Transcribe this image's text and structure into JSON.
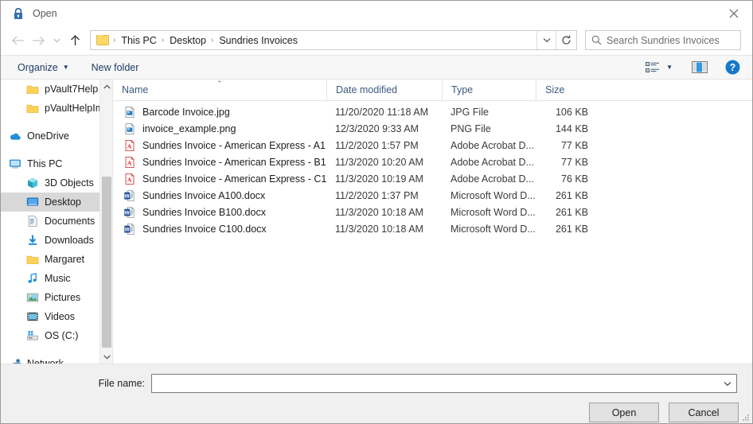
{
  "window": {
    "title": "Open",
    "lock_icon": "lock-icon",
    "close_icon": "close-icon"
  },
  "address": {
    "back_icon": "back-arrow-icon",
    "forward_icon": "forward-arrow-icon",
    "recent_icon": "chevron-down-icon",
    "up_icon": "up-arrow-icon",
    "folder_icon": "folder-icon",
    "breadcrumbs": [
      "This PC",
      "Desktop",
      "Sundries Invoices"
    ],
    "separator": "›",
    "dropdown_icon": "chevron-down-icon",
    "refresh_icon": "refresh-icon"
  },
  "search": {
    "icon": "search-icon",
    "placeholder": "Search Sundries Invoices"
  },
  "toolbar": {
    "organize_label": "Organize",
    "organize_caret": "▼",
    "new_folder_label": "New folder",
    "view_icon": "view-options-icon",
    "view_caret": "▼",
    "preview_icon": "preview-pane-icon",
    "help_icon": "help-icon"
  },
  "sidebar": {
    "items": [
      {
        "label": "pVault7Help",
        "icon": "folder-icon",
        "indent": 1,
        "selected": false
      },
      {
        "label": "pVaultHelpImag",
        "icon": "folder-icon",
        "indent": 1,
        "selected": false
      },
      {
        "label": "",
        "icon": "spacer",
        "indent": 0,
        "selected": false
      },
      {
        "label": "OneDrive",
        "icon": "onedrive-icon",
        "indent": 0,
        "selected": false
      },
      {
        "label": "",
        "icon": "spacer",
        "indent": 0,
        "selected": false
      },
      {
        "label": "This PC",
        "icon": "this-pc-icon",
        "indent": 0,
        "selected": false
      },
      {
        "label": "3D Objects",
        "icon": "3d-objects-icon",
        "indent": 1,
        "selected": false
      },
      {
        "label": "Desktop",
        "icon": "desktop-icon",
        "indent": 1,
        "selected": true
      },
      {
        "label": "Documents",
        "icon": "documents-icon",
        "indent": 1,
        "selected": false
      },
      {
        "label": "Downloads",
        "icon": "downloads-icon",
        "indent": 1,
        "selected": false
      },
      {
        "label": "Margaret",
        "icon": "folder-icon",
        "indent": 1,
        "selected": false
      },
      {
        "label": "Music",
        "icon": "music-icon",
        "indent": 1,
        "selected": false
      },
      {
        "label": "Pictures",
        "icon": "pictures-icon",
        "indent": 1,
        "selected": false
      },
      {
        "label": "Videos",
        "icon": "videos-icon",
        "indent": 1,
        "selected": false
      },
      {
        "label": "OS (C:)",
        "icon": "drive-icon",
        "indent": 1,
        "selected": false
      },
      {
        "label": "",
        "icon": "spacer",
        "indent": 0,
        "selected": false
      },
      {
        "label": "Network",
        "icon": "network-icon",
        "indent": 0,
        "selected": false
      }
    ],
    "scroll_up_icon": "chevron-up-icon",
    "scroll_down_icon": "chevron-down-icon"
  },
  "filelist": {
    "columns": [
      "Name",
      "Date modified",
      "Type",
      "Size"
    ],
    "sort_indicator": "⌃",
    "rows": [
      {
        "name": "Barcode Invoice.jpg",
        "date": "11/20/2020 11:18 AM",
        "type": "JPG File",
        "size": "106 KB",
        "icon": "image-file-icon"
      },
      {
        "name": "invoice_example.png",
        "date": "12/3/2020 9:33 AM",
        "type": "PNG File",
        "size": "144 KB",
        "icon": "image-file-icon"
      },
      {
        "name": "Sundries Invoice - American Express - A1...",
        "date": "11/2/2020 1:57 PM",
        "type": "Adobe Acrobat D...",
        "size": "77 KB",
        "icon": "pdf-file-icon"
      },
      {
        "name": "Sundries Invoice - American Express - B1...",
        "date": "11/3/2020 10:20 AM",
        "type": "Adobe Acrobat D...",
        "size": "77 KB",
        "icon": "pdf-file-icon"
      },
      {
        "name": "Sundries Invoice - American Express - C1...",
        "date": "11/3/2020 10:19 AM",
        "type": "Adobe Acrobat D...",
        "size": "76 KB",
        "icon": "pdf-file-icon"
      },
      {
        "name": "Sundries Invoice A100.docx",
        "date": "11/2/2020 1:37 PM",
        "type": "Microsoft Word D...",
        "size": "261 KB",
        "icon": "word-file-icon"
      },
      {
        "name": "Sundries Invoice B100.docx",
        "date": "11/3/2020 10:18 AM",
        "type": "Microsoft Word D...",
        "size": "261 KB",
        "icon": "word-file-icon"
      },
      {
        "name": "Sundries Invoice C100.docx",
        "date": "11/3/2020 10:18 AM",
        "type": "Microsoft Word D...",
        "size": "261 KB",
        "icon": "word-file-icon"
      }
    ]
  },
  "footer": {
    "filename_label": "File name:",
    "filename_value": "",
    "filename_placeholder": "",
    "filename_chevron": "chevron-down-icon",
    "open_label": "Open",
    "cancel_label": "Cancel",
    "resize_grip": "resize-grip-icon"
  },
  "colors": {
    "accent_blue": "#0078d7",
    "folder_yellow": "#ffd257",
    "pdf_red": "#e02020",
    "word_blue": "#2b579a",
    "selection_grey": "#d8d8d8"
  }
}
